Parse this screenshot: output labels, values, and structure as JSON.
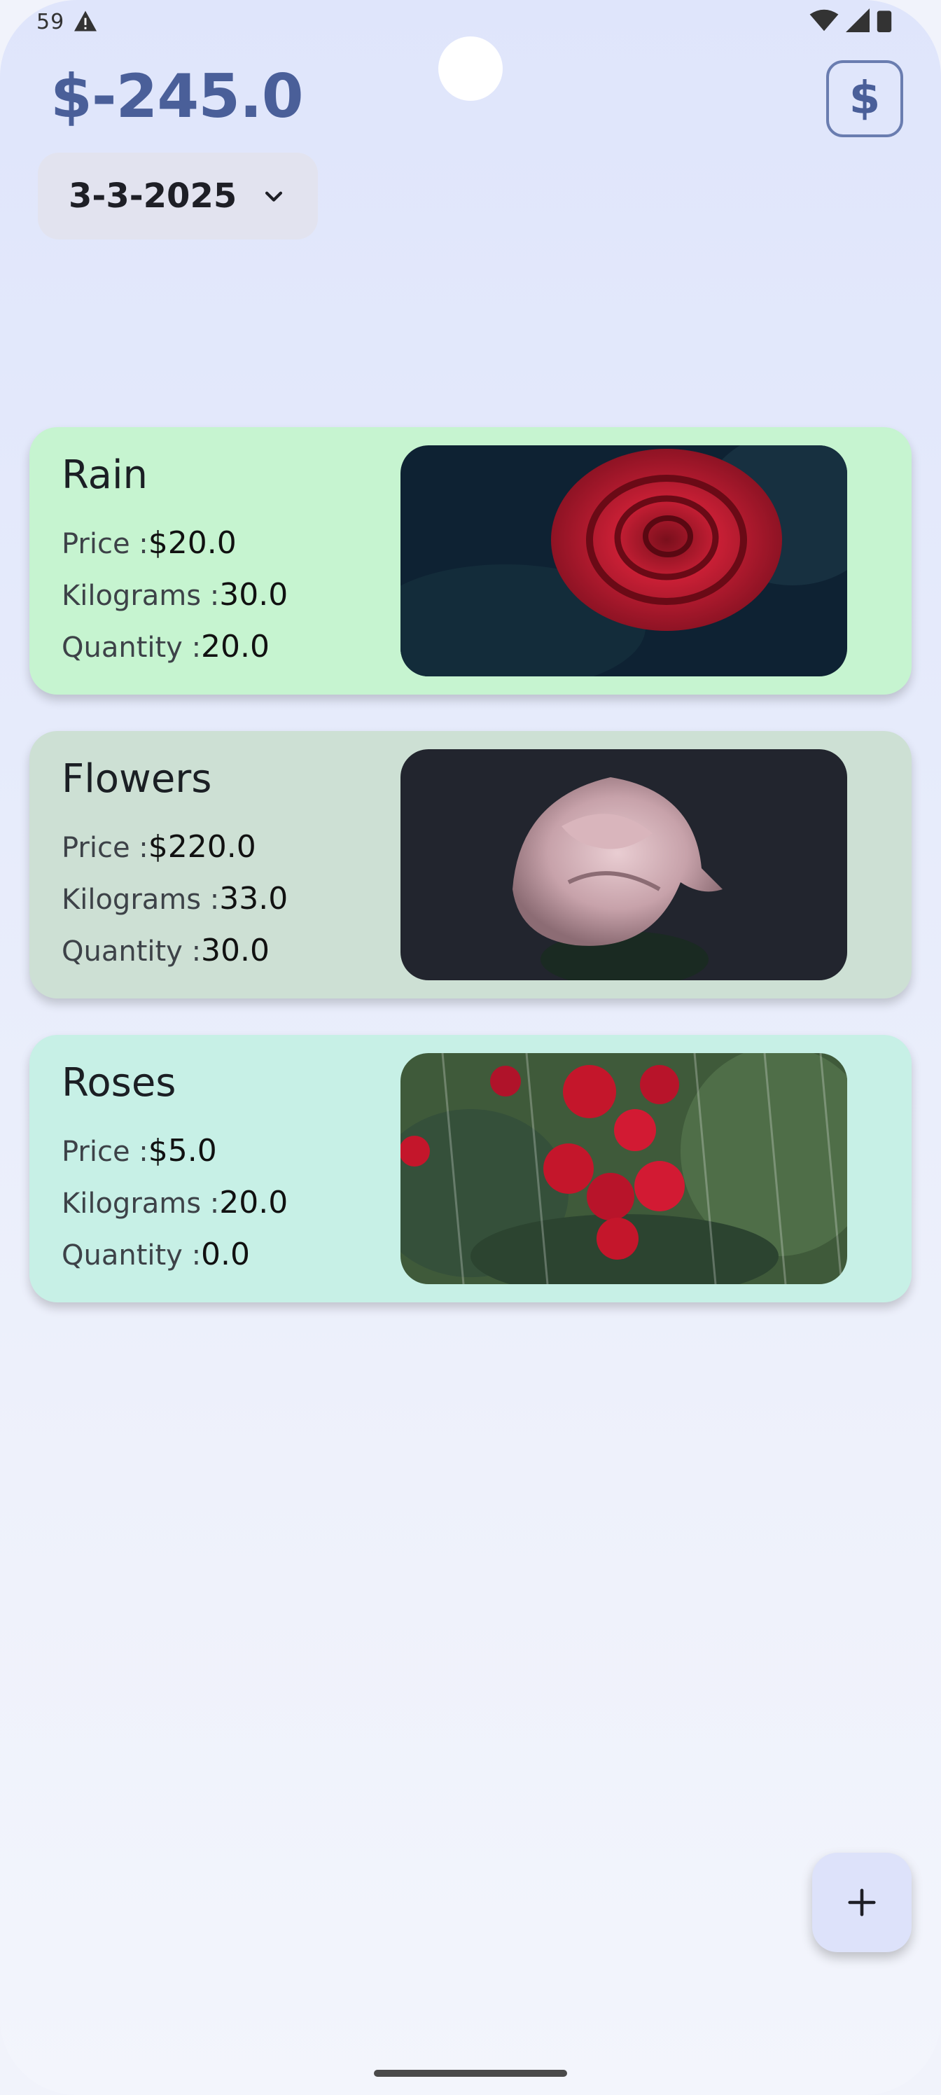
{
  "status_bar": {
    "time": "59",
    "icons": [
      "warning-icon",
      "wifi-icon",
      "signal-icon",
      "battery-icon"
    ]
  },
  "header": {
    "balance": "$-245.0",
    "currency_button_label": "$"
  },
  "date_filter": {
    "selected": "3-3-2025"
  },
  "labels": {
    "price": "Price :",
    "kilograms": "Kilograms :",
    "quantity": "Quantity :"
  },
  "items": [
    {
      "name": "Rain",
      "price": "$20.0",
      "kilograms": "30.0",
      "quantity": "20.0",
      "card_color": "#c6f4d0",
      "image": "red rose with raindrops"
    },
    {
      "name": "Flowers",
      "price": "$220.0",
      "kilograms": "33.0",
      "quantity": "30.0",
      "card_color": "#cde0d4",
      "image": "pale pink rose on dark background"
    },
    {
      "name": "Roses",
      "price": "$5.0",
      "kilograms": "20.0",
      "quantity": "0.0",
      "card_color": "#c7f0e6",
      "image": "red rose bush in rain"
    }
  ],
  "fab": {
    "label": "+"
  },
  "colors": {
    "accent": "#4a5f99",
    "background": "#e6ebfb"
  }
}
